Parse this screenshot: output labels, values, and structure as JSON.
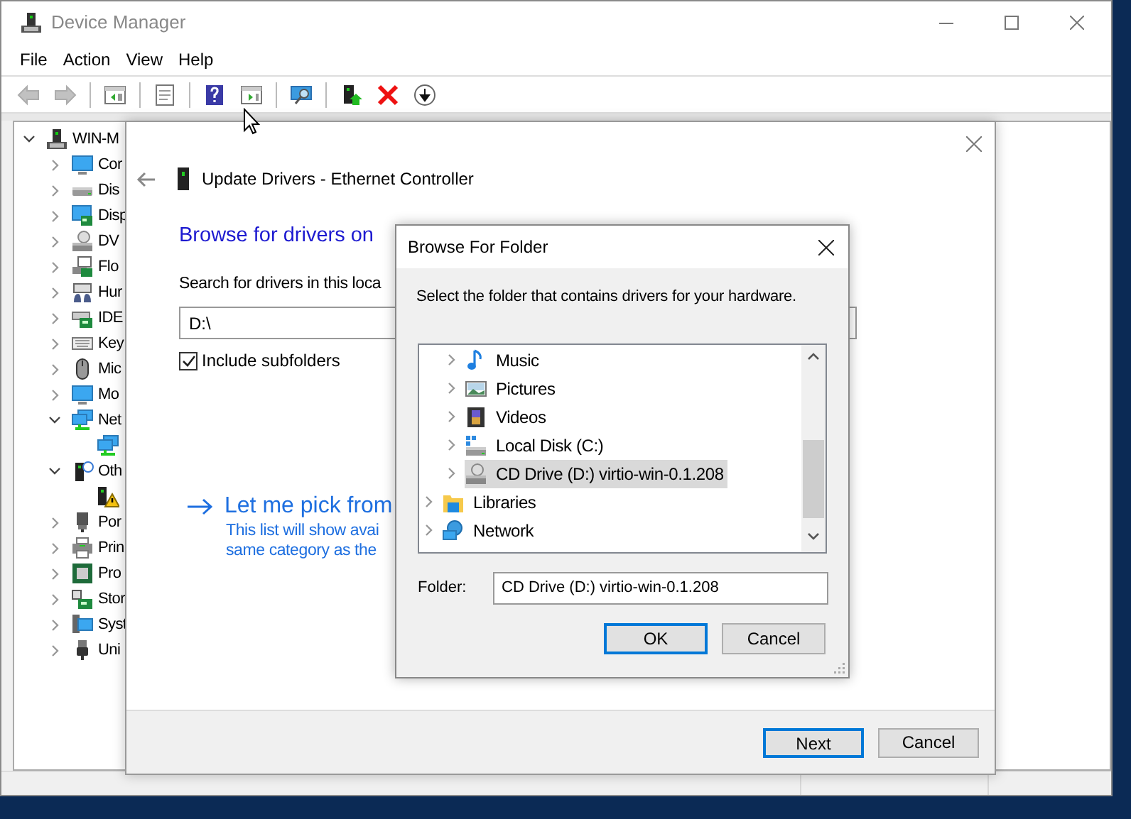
{
  "window": {
    "title": "Device Manager",
    "active": false
  },
  "menu": [
    "File",
    "Action",
    "View",
    "Help"
  ],
  "toolbar": [
    {
      "kind": "back",
      "disabled": true
    },
    {
      "kind": "forward",
      "disabled": true
    },
    {
      "kind": "sep"
    },
    {
      "kind": "console-tree"
    },
    {
      "kind": "sep"
    },
    {
      "kind": "properties"
    },
    {
      "kind": "sep"
    },
    {
      "kind": "help"
    },
    {
      "kind": "action-pane"
    },
    {
      "kind": "sep"
    },
    {
      "kind": "scan"
    },
    {
      "kind": "sep"
    },
    {
      "kind": "update"
    },
    {
      "kind": "uninstall"
    },
    {
      "kind": "download"
    }
  ],
  "device_tree": [
    {
      "label": "WIN-M",
      "kind": "computer",
      "expanded": true,
      "children": [
        {
          "label": "Cor",
          "kind": "monitor",
          "expanded": false
        },
        {
          "label": "Dis",
          "kind": "disk",
          "expanded": false
        },
        {
          "label": "Disp",
          "kind": "display",
          "expanded": false
        },
        {
          "label": "DV",
          "kind": "dvd",
          "expanded": false
        },
        {
          "label": "Flo",
          "kind": "floppy",
          "expanded": false
        },
        {
          "label": "Hur",
          "kind": "hid",
          "expanded": false
        },
        {
          "label": "IDE",
          "kind": "ide",
          "expanded": false
        },
        {
          "label": "Key",
          "kind": "keyboard",
          "expanded": false
        },
        {
          "label": "Mic",
          "kind": "mouse",
          "expanded": false
        },
        {
          "label": "Mo",
          "kind": "monitor",
          "expanded": false
        },
        {
          "label": "Net",
          "kind": "network",
          "expanded": true,
          "children": [
            {
              "kind": "network"
            }
          ]
        },
        {
          "label": "Oth",
          "kind": "unknown",
          "expanded": true,
          "children": [
            {
              "kind": "warning"
            }
          ]
        },
        {
          "label": "Por",
          "kind": "port",
          "expanded": false
        },
        {
          "label": "Prin",
          "kind": "printer",
          "expanded": false
        },
        {
          "label": "Pro",
          "kind": "cpu",
          "expanded": false
        },
        {
          "label": "Stor",
          "kind": "storage",
          "expanded": false
        },
        {
          "label": "Syst",
          "kind": "system",
          "expanded": false
        },
        {
          "label": "Uni",
          "kind": "usb",
          "expanded": false
        }
      ]
    }
  ],
  "wizard": {
    "title": "Update Drivers - Ethernet Controller",
    "heading": "Browse for drivers on",
    "search_label": "Search for drivers in this loca",
    "path": "D:\\",
    "include_subfolders": {
      "label": "Include subfolders",
      "checked": true
    },
    "pick_link": "Let me pick from",
    "pick_description": [
      "This list will show avai",
      "same category as the"
    ],
    "buttons": [
      {
        "label": "Next",
        "default": true
      },
      {
        "label": "Cancel",
        "default": false
      }
    ]
  },
  "browse_dialog": {
    "title": "Browse For Folder",
    "instruction": "Select the folder that contains drivers for your hardware.",
    "folder_tree": {
      "nested_items": [
        {
          "label": "Music",
          "kind": "music",
          "selected": false
        },
        {
          "label": "Pictures",
          "kind": "pictures",
          "selected": false
        },
        {
          "label": "Videos",
          "kind": "videos",
          "selected": false
        },
        {
          "label": "Local Disk (C:)",
          "kind": "localdisk",
          "selected": false
        },
        {
          "label": "CD Drive (D:) virtio-win-0.1.208",
          "kind": "cd",
          "selected": true
        }
      ],
      "top_level_items": [
        {
          "label": "Libraries",
          "kind": "libraries",
          "selected": false
        },
        {
          "label": "Network",
          "kind": "netplace",
          "selected": false
        }
      ]
    },
    "folder_label": "Folder:",
    "folder_value": "CD Drive (D:) virtio-win-0.1.208",
    "buttons": [
      {
        "label": "OK",
        "default": true
      },
      {
        "label": "Cancel",
        "default": false
      }
    ]
  }
}
